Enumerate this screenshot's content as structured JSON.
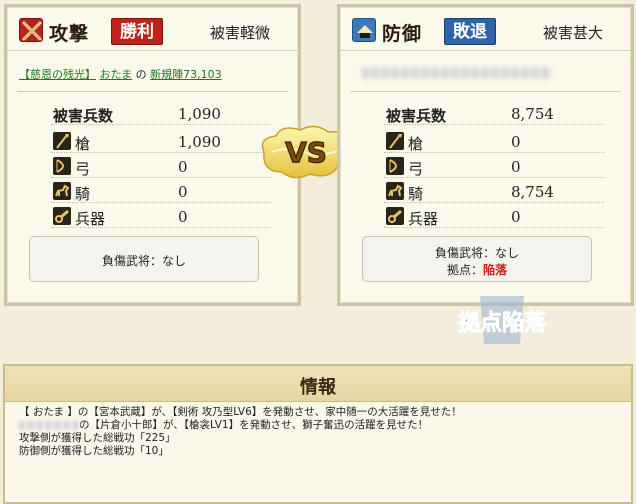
{
  "attacker": {
    "side_label": "攻撃",
    "result": "勝利",
    "damage_level": "被害軽微",
    "alliance": "【慈恩の残光】",
    "player": "おたま",
    "connector": "の",
    "base": "新規陣73,103",
    "total_label": "被害兵数",
    "total_value": "1,090",
    "troops": [
      {
        "label": "槍",
        "value": "1,090"
      },
      {
        "label": "弓",
        "value": "0"
      },
      {
        "label": "騎",
        "value": "0"
      },
      {
        "label": "兵器",
        "value": "0"
      }
    ],
    "casualty": "負傷武将：なし"
  },
  "defender": {
    "side_label": "防御",
    "result": "敗退",
    "damage_level": "被害甚大",
    "total_label": "被害兵数",
    "total_value": "8,754",
    "troops": [
      {
        "label": "槍",
        "value": "0"
      },
      {
        "label": "弓",
        "value": "0"
      },
      {
        "label": "騎",
        "value": "8,754"
      },
      {
        "label": "兵器",
        "value": "0"
      }
    ],
    "casualty": "負傷武将：なし",
    "base_status_label": "拠点：",
    "base_status_value": "陥落"
  },
  "vs_text": "VS",
  "stamp_text": "拠点陥落",
  "info": {
    "title": "情報",
    "lines": [
      {
        "text": "【 おたま 】の【宮本武蔵】が、【剣術 攻乃型LV6】を発動させ、家中随一の大活躍を見せた！",
        "redacted": false
      },
      {
        "text": "の【片倉小十郎】が、【槍衾LV1】を発動させ、獅子奮迅の活躍を見せた！",
        "redacted": true
      },
      {
        "text": "攻撃側が獲得した総戦功「225」",
        "redacted": false
      },
      {
        "text": "防御側が獲得した総戦功「10」",
        "redacted": false
      }
    ]
  },
  "colors": {
    "win": "#c0221b",
    "lose": "#2f65a5",
    "fallen": "#d01f1a",
    "link": "#1d7a1d"
  }
}
